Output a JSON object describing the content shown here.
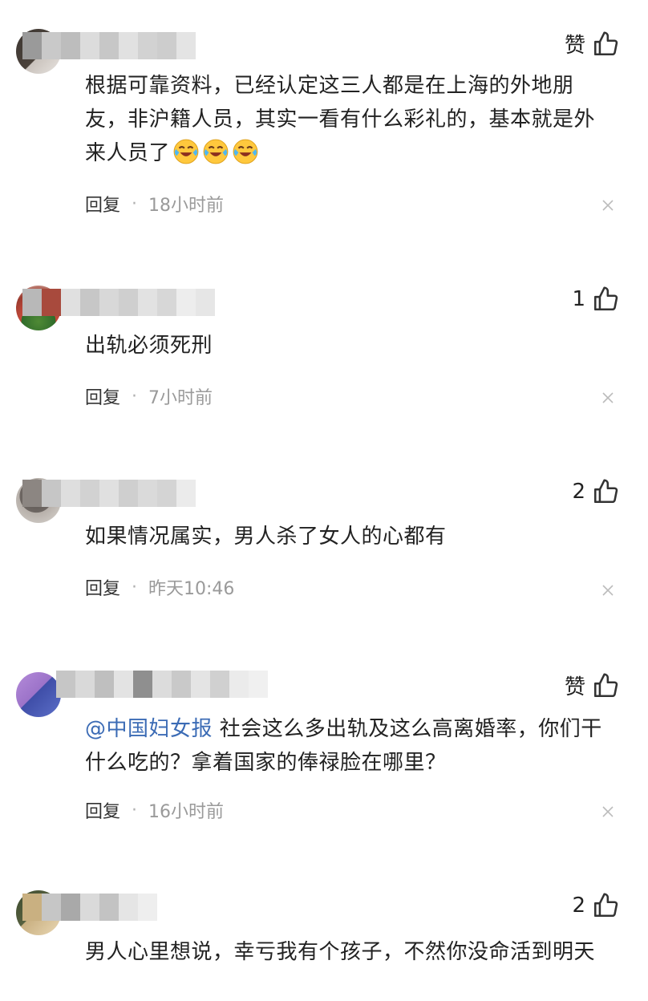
{
  "comments": [
    {
      "likes": "赞",
      "text": "根据可靠资料，已经认定这三人都是在上海的外地朋友，非沪籍人员，其实一看有什么彩礼的，基本就是外来人员了",
      "emojis": [
        "laugh-cry-emoji",
        "laugh-cry-emoji",
        "laugh-cry-emoji"
      ],
      "reply": "回复",
      "time": "18小时前"
    },
    {
      "likes": "1",
      "text": "出轨必须死刑",
      "reply": "回复",
      "time": "7小时前"
    },
    {
      "likes": "2",
      "text": "如果情况属实，男人杀了女人的心都有",
      "reply": "回复",
      "time": "昨天10:46"
    },
    {
      "likes": "赞",
      "mention": "@中国妇女报",
      "text": " 社会这么多出轨及这么高离婚率，你们干什么吃的？拿着国家的俸禄脸在哪里？",
      "reply": "回复",
      "time": "16小时前"
    },
    {
      "likes": "2",
      "text": "男人心里想说，幸亏我有个孩子，不然你没命活到明天"
    }
  ],
  "colors": {
    "mention": "#3b6bb5",
    "meta": "#9a9a9a",
    "text": "#222222"
  }
}
